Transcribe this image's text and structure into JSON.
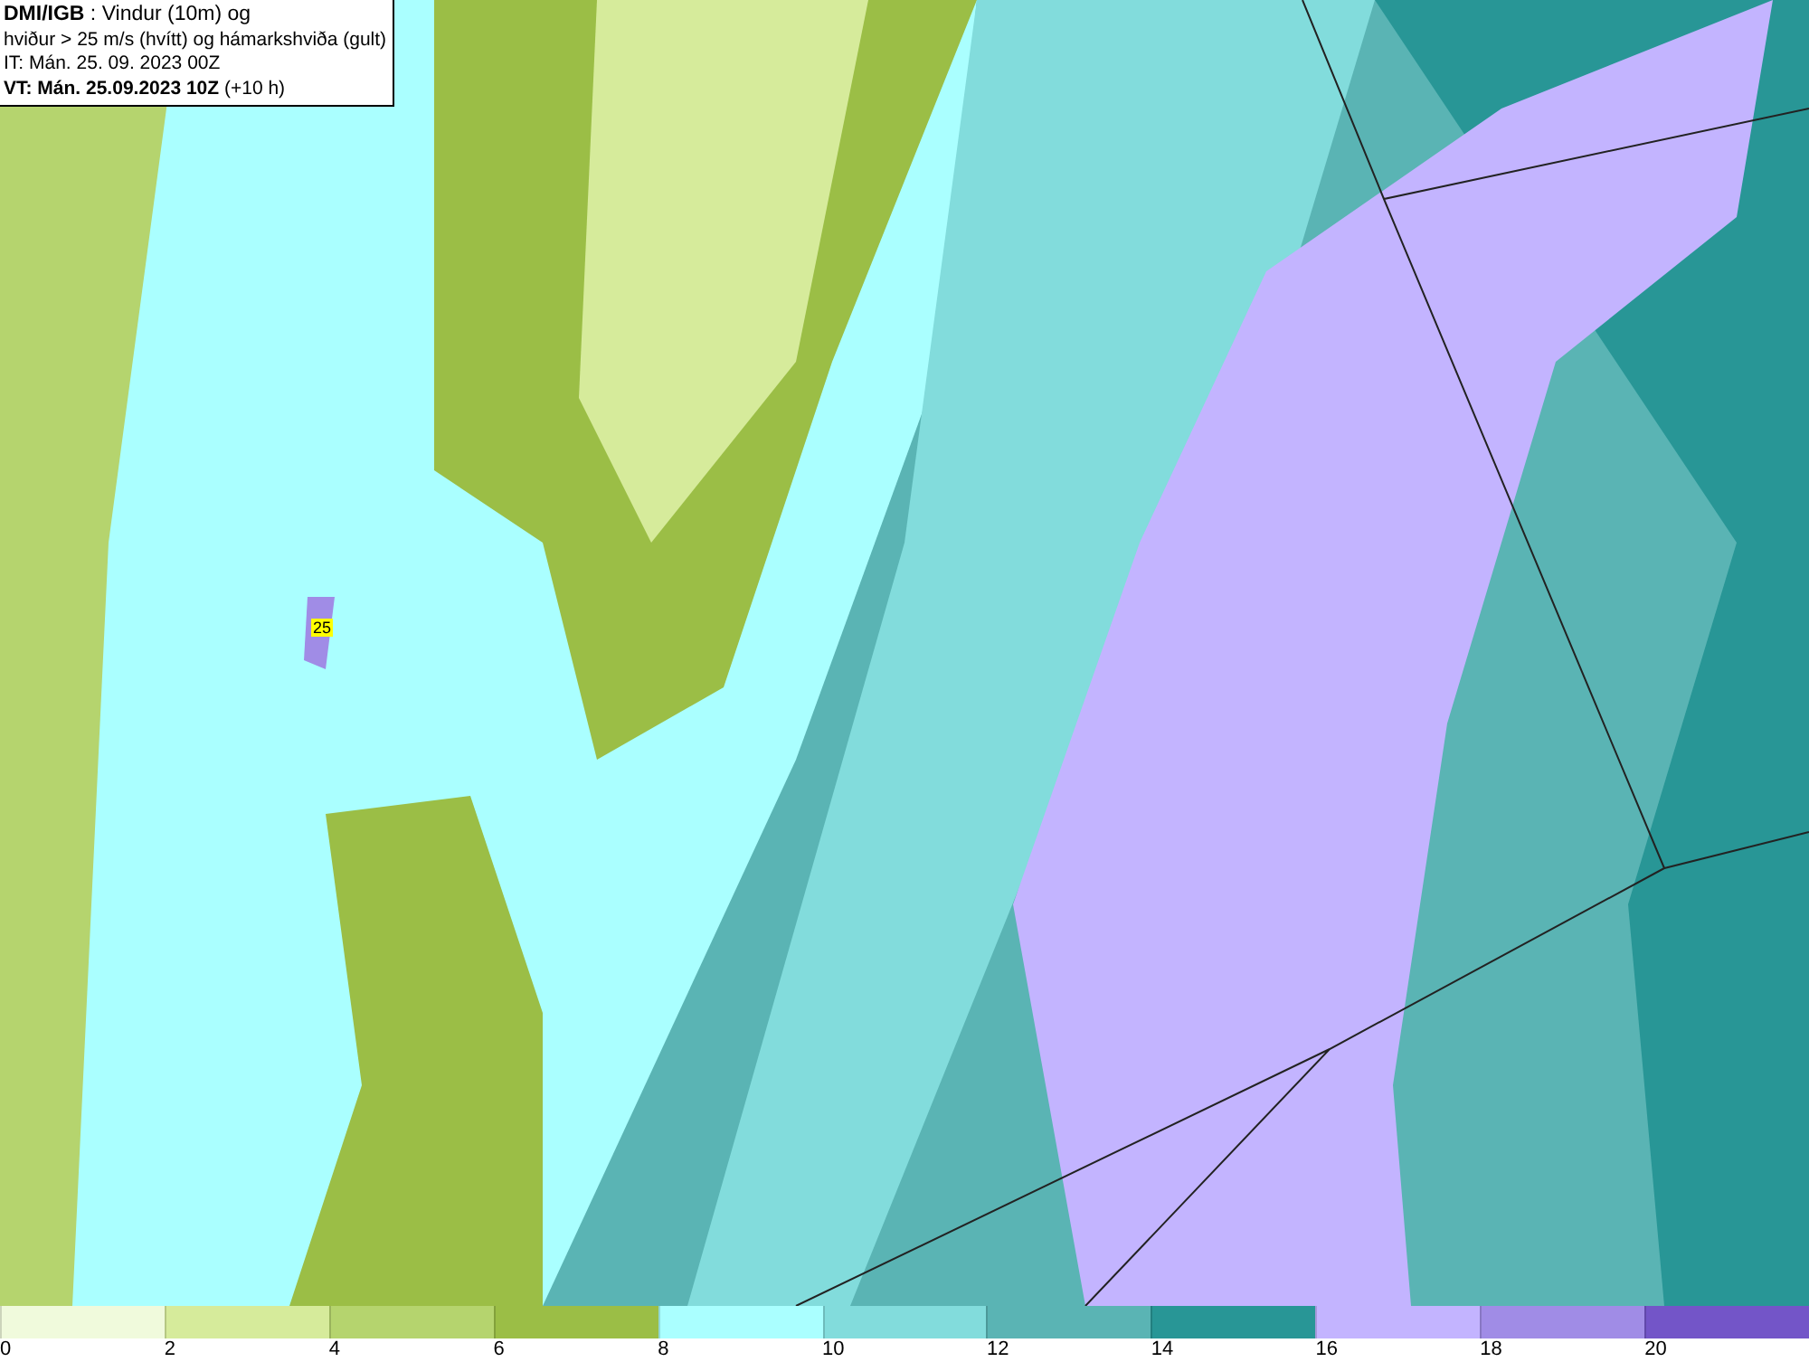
{
  "map": {
    "title_lines": [
      "**DMI/IGB** : Vindur (10m) og",
      "hviður > 25 m/s (hvítt) og hámarkshviða (gult)",
      "IT: Mán. 25. 09. 2023 00Z",
      "**VT: Mán. 25.09.2023 10Z** (+10 h)"
    ],
    "gust_labels": [
      {
        "text": "25"
      }
    ]
  },
  "legend": [
    {
      "label": "0",
      "color": "#f0fadc"
    },
    {
      "label": "2",
      "color": "#d6eb9b"
    },
    {
      "label": "4",
      "color": "#b5d46e"
    },
    {
      "label": "6",
      "color": "#9bbe46"
    },
    {
      "label": "8",
      "color": "#aaffff"
    },
    {
      "label": "10",
      "color": "#82dcdc"
    },
    {
      "label": "12",
      "color": "#5ab4b4"
    },
    {
      "label": "14",
      "color": "#289696"
    },
    {
      "label": "16",
      "color": "#c3b4ff"
    },
    {
      "label": "18",
      "color": "#a08ce6"
    },
    {
      "label": "20",
      "color": "#7355c8"
    }
  ]
}
